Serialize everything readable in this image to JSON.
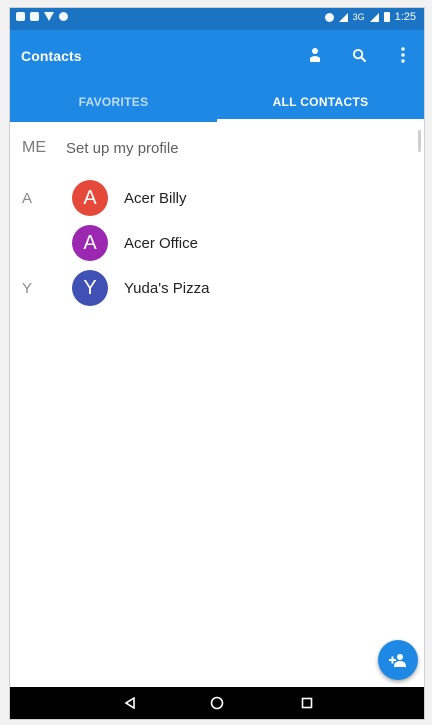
{
  "status_bar": {
    "network": "3G",
    "time": "1:25"
  },
  "app_bar": {
    "title": "Contacts",
    "actions": [
      "person-icon",
      "search-icon",
      "more-vert-icon"
    ]
  },
  "tabs": [
    {
      "label": "FAVORITES",
      "active": false
    },
    {
      "label": "ALL CONTACTS",
      "active": true
    }
  ],
  "profile": {
    "label": "ME",
    "text": "Set up my profile"
  },
  "contacts": [
    {
      "section": "A",
      "initial": "A",
      "name": "Acer Billy",
      "color": "#e5493a"
    },
    {
      "section": "",
      "initial": "A",
      "name": "Acer Office",
      "color": "#9c27b0"
    },
    {
      "section": "Y",
      "initial": "Y",
      "name": "Yuda's Pizza",
      "color": "#3f51b5"
    }
  ],
  "fab": {
    "icon": "add-person-icon",
    "color": "#1e88e5"
  },
  "nav": [
    "back-icon",
    "home-icon",
    "recents-icon"
  ],
  "colors": {
    "primary": "#1e88e5",
    "status": "#1b73c4"
  }
}
